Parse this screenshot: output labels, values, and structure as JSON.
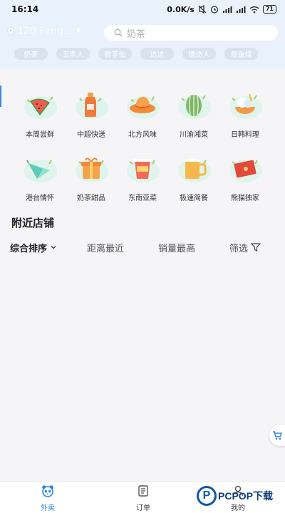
{
  "status_bar": {
    "time": "16:14",
    "speed": "0.0K/s",
    "battery": "71",
    "icons": [
      "mute-icon",
      "alarm-icon",
      "signal-icon",
      "signal-icon",
      "wifi-icon",
      "battery-icon"
    ]
  },
  "header": {
    "location": "120 Feng...",
    "search_placeholder": "奶茶",
    "chips": [
      "奶茶",
      "五条人",
      "鲜芋仙",
      "达达",
      "德达人",
      "章鱼烧"
    ]
  },
  "categories": [
    {
      "label": "本周尝鲜",
      "icon": "watermelon-icon"
    },
    {
      "label": "中超快送",
      "icon": "bottle-icon"
    },
    {
      "label": "北方风味",
      "icon": "hat-icon"
    },
    {
      "label": "川渝湘菜",
      "icon": "melon-icon"
    },
    {
      "label": "日韩料理",
      "icon": "icecream-icon"
    },
    {
      "label": "港台情怀",
      "icon": "umbrella-icon"
    },
    {
      "label": "奶茶甜品",
      "icon": "gift-icon"
    },
    {
      "label": "东南亚菜",
      "icon": "cup-icon"
    },
    {
      "label": "极速简餐",
      "icon": "beer-icon"
    },
    {
      "label": "熊猫独家",
      "icon": "redpacket-icon"
    }
  ],
  "nearby": {
    "title": "附近店铺",
    "sort": {
      "comprehensive": "综合排序",
      "distance": "距离最近",
      "sales": "销量最高",
      "filter": "筛选"
    }
  },
  "tabbar": {
    "home": "外卖",
    "orders": "订单",
    "mine": "我的"
  },
  "watermark": {
    "text": "PCPOP下载"
  },
  "colors": {
    "accent": "#2e86de",
    "header_bg": "#e9f2fb",
    "page_bg": "#f5f5f7"
  }
}
